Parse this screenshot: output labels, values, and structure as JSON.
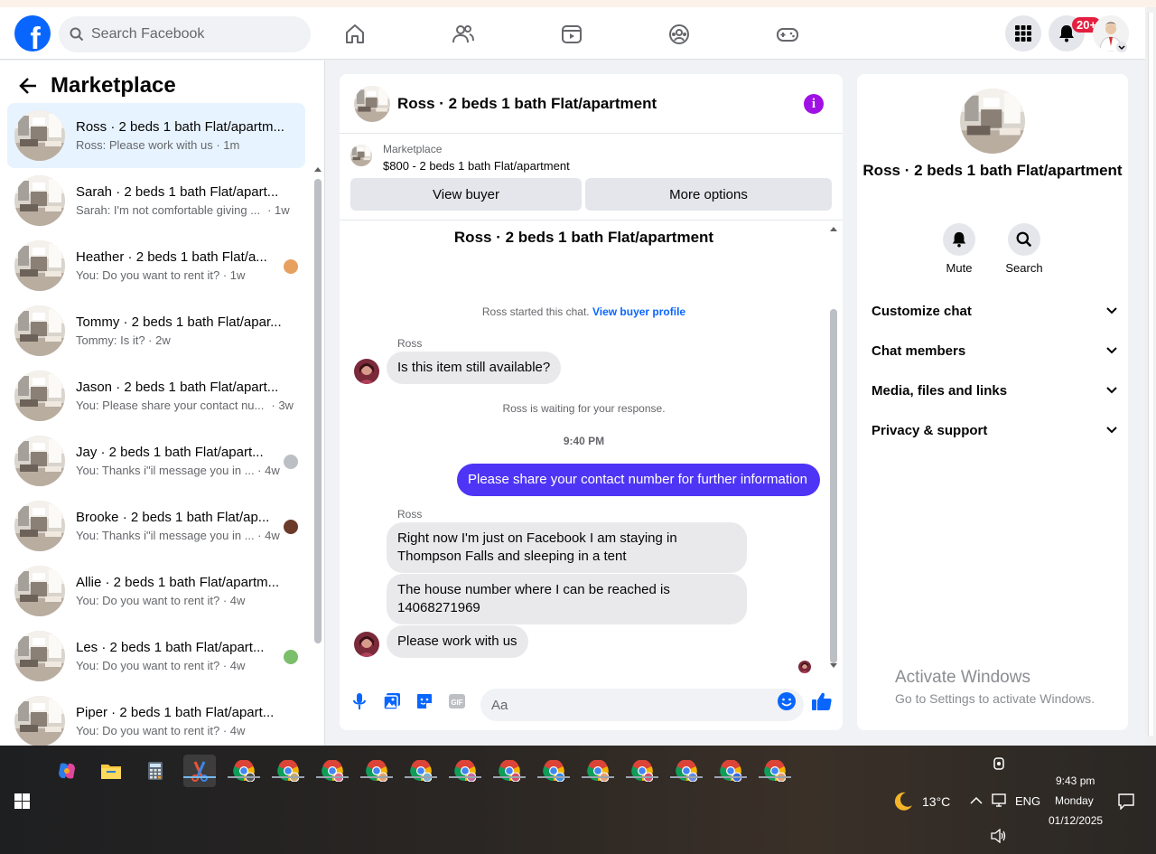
{
  "topbar": {
    "search_placeholder": "Search Facebook",
    "notifications_badge": "20+"
  },
  "sidebar": {
    "title": "Marketplace",
    "conversations": [
      {
        "title": "Ross · 2 beds 1 bath Flat/apartm...",
        "preview": "Ross: Please work with us · 1m",
        "active": true
      },
      {
        "title": "Sarah · 2 beds 1 bath Flat/apart...",
        "preview": "Sarah: I'm not comfortable giving ...",
        "time": "· 1w"
      },
      {
        "title": "Heather · 2 beds 1 bath Flat/a...",
        "preview": "You: Do you want to rent it? · 1w"
      },
      {
        "title": "Tommy · 2 beds 1 bath Flat/apar...",
        "preview": "Tommy: Is it? · 2w"
      },
      {
        "title": "Jason · 2 beds 1 bath Flat/apart...",
        "preview": "You: Please share your contact nu...",
        "time": "· 3w"
      },
      {
        "title": "Jay · 2 beds 1 bath Flat/apart...",
        "preview": "You: Thanks i\"il message you in ... · 4w"
      },
      {
        "title": "Brooke · 2 beds 1 bath Flat/ap...",
        "preview": "You: Thanks i\"il message you in ... · 4w"
      },
      {
        "title": "Allie · 2 beds 1 bath Flat/apartm...",
        "preview": "You: Do you want to rent it? · 4w"
      },
      {
        "title": "Les · 2 beds 1 bath Flat/apart...",
        "preview": "You: Do you want to rent it? · 4w"
      },
      {
        "title": "Piper · 2 beds 1 bath Flat/apart...",
        "preview": "You: Do you want to rent it? · 4w"
      }
    ]
  },
  "chat": {
    "header_title": "Ross · 2 beds 1 bath Flat/apartment",
    "marketplace_label": "Marketplace",
    "listing": "$800 - 2 beds 1 bath Flat/apartment",
    "view_buyer": "View buyer",
    "more_options": "More options",
    "body_title": "Ross · 2 beds 1 bath Flat/apartment",
    "started_text": "Ross started this chat.",
    "view_buyer_profile": "View buyer profile",
    "sender1": "Ross",
    "msg1": "Is this item still available?",
    "waiting": "Ross is waiting for your response.",
    "timestamp": "9:40 PM",
    "msg_me": "Please share your contact number for further information",
    "sender2": "Ross",
    "msg2": "Right now I'm just on Facebook I am staying in Thompson Falls and sleeping in a tent",
    "msg3": "The house number where I can be reached is 14068271969",
    "msg4": "Please work with us",
    "composer_placeholder": "Aa"
  },
  "details": {
    "name": "Ross · 2 beds 1 bath Flat/apartment",
    "mute_label": "Mute",
    "search_label": "Search",
    "sections": [
      "Customize chat",
      "Chat members",
      "Media, files and links",
      "Privacy & support"
    ]
  },
  "watermark": {
    "line1": "Activate Windows",
    "line2": "Go to Settings to activate Windows."
  },
  "taskbar": {
    "weather": "13°C",
    "lang": "ENG",
    "time": "9:43 pm",
    "day": "Monday",
    "date": "01/12/2025"
  },
  "colors": {
    "brand": "#0866ff",
    "my_bubble": "#4e35f5",
    "info": "#a010e5"
  }
}
